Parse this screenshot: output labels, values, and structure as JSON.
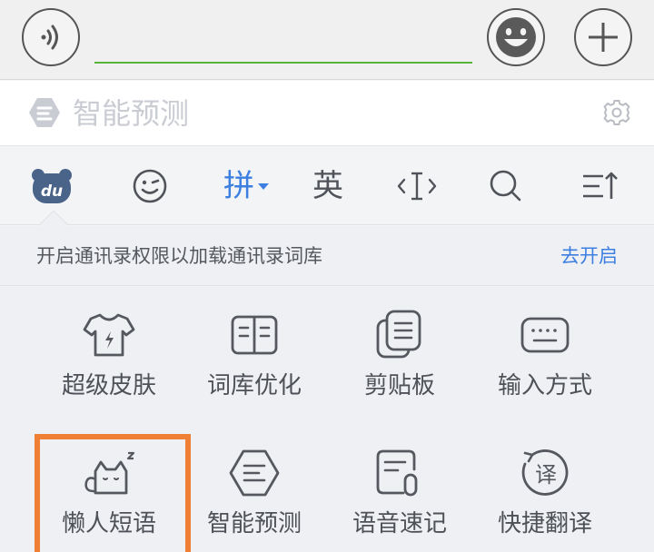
{
  "chat_bar": {
    "input_value": "",
    "input_placeholder": ""
  },
  "prediction": {
    "label": "智能预测"
  },
  "toolbar": {
    "items": [
      {
        "name": "du-logo",
        "label": "du"
      },
      {
        "name": "emoji",
        "label": ""
      },
      {
        "name": "pinyin",
        "label": "拼"
      },
      {
        "name": "english",
        "label": "英"
      },
      {
        "name": "cursor",
        "label": ""
      },
      {
        "name": "search",
        "label": ""
      },
      {
        "name": "collapse",
        "label": ""
      }
    ]
  },
  "notice": {
    "text": "开启通讯录权限以加载通讯录词库",
    "action": "去开启"
  },
  "tools": [
    {
      "label": "超级皮肤",
      "icon": "shirt-icon"
    },
    {
      "label": "词库优化",
      "icon": "book-icon"
    },
    {
      "label": "剪贴板",
      "icon": "clipboard-icon"
    },
    {
      "label": "输入方式",
      "icon": "keyboard-icon"
    },
    {
      "label": "懒人短语",
      "icon": "sleepy-cat-icon"
    },
    {
      "label": "智能预测",
      "icon": "predict-icon"
    },
    {
      "label": "语音速记",
      "icon": "voice-note-icon"
    },
    {
      "label": "快捷翻译",
      "icon": "translate-icon"
    }
  ],
  "colors": {
    "accent_blue": "#3d7fe0",
    "input_underline": "#58b53a",
    "highlight_orange": "#ee7f34"
  }
}
